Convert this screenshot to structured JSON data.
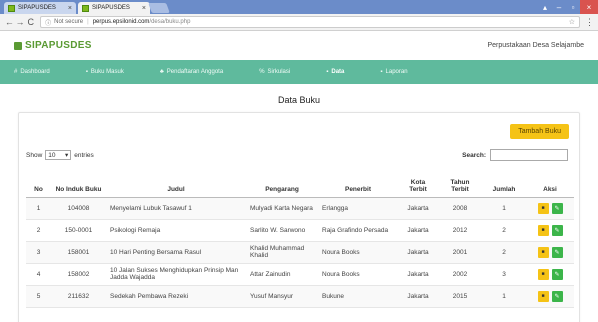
{
  "browser": {
    "tabs": [
      {
        "title": "SIPAPUSDES",
        "active": false
      },
      {
        "title": "SIPAPUSDES",
        "active": true
      }
    ],
    "security_label": "Not secure",
    "url_host": "perpus.epsilonid.com",
    "url_path": "/desa/buku.php"
  },
  "app": {
    "brand": "SIPAPUSDES",
    "org_name": "Perpustakaan Desa Selajambe"
  },
  "nav": [
    {
      "label": "Dashboard",
      "icon": "#",
      "active": false
    },
    {
      "label": "Buku Masuk",
      "icon": "▪",
      "active": false
    },
    {
      "label": "Pendaftaran Anggota",
      "icon": "♣",
      "active": false
    },
    {
      "label": "Sirkulasi",
      "icon": "%",
      "active": false
    },
    {
      "label": "Data",
      "icon": "▪",
      "active": true
    },
    {
      "label": "Laporan",
      "icon": "▪",
      "active": false
    }
  ],
  "page_title": "Data Buku",
  "add_button": "Tambah Buku",
  "length": {
    "show": "Show",
    "value": "10",
    "entries": "entries"
  },
  "search_label": "Search:",
  "table": {
    "headers": [
      "No",
      "No Induk Buku",
      "Judul",
      "Pengarang",
      "Penerbit",
      "Kota Terbit",
      "Tahun Terbit",
      "Jumlah",
      "Aksi"
    ],
    "rows": [
      [
        "1",
        "104008",
        "Menyelami Lubuk Tasawuf 1",
        "Mulyadi Karta Negara",
        "Erlangga",
        "Jakarta",
        "2008",
        "1"
      ],
      [
        "2",
        "150-0001",
        "Psikologi Remaja",
        "Sarlito W. Sarwono",
        "Raja Grafindo Persada",
        "Jakarta",
        "2012",
        "2"
      ],
      [
        "3",
        "158001",
        "10 Hari Penting Bersama Rasul",
        "Khalid Muhammad Khalid",
        "Noura Books",
        "Jakarta",
        "2001",
        "2"
      ],
      [
        "4",
        "158002",
        "10 Jalan Sukses Menghidupkan Prinsip Man Jadda Wajadda",
        "Attar Zainudin",
        "Noura Books",
        "Jakarta",
        "2002",
        "3"
      ],
      [
        "5",
        "211632",
        "Sedekah Pembawa Rezeki",
        "Yusuf Mansyur",
        "Bukune",
        "Jakarta",
        "2015",
        "1"
      ]
    ]
  },
  "colors": {
    "nav": "#5fba9d",
    "brand": "#5a9a33",
    "warning": "#f5c316",
    "success": "#3cb54a"
  }
}
